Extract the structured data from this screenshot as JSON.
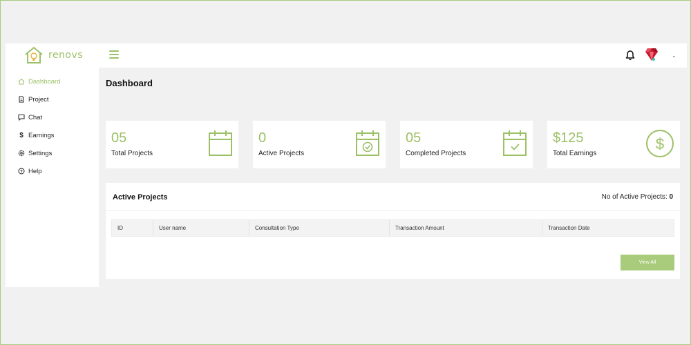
{
  "brand": {
    "name": "renovs",
    "accent": "#9cc066"
  },
  "topbar": {
    "menu_icon": "hamburger-icon",
    "notification_icon": "bell-icon",
    "avatar_icon": "ruby-avatar",
    "dropdown_icon": "chevron-down-icon"
  },
  "sidebar": {
    "items": [
      {
        "label": "Dashboard",
        "icon": "home-icon",
        "active": true
      },
      {
        "label": "Project",
        "icon": "document-icon",
        "active": false
      },
      {
        "label": "Chat",
        "icon": "chat-icon",
        "active": false
      },
      {
        "label": "Earnings",
        "icon": "dollar-icon",
        "active": false
      },
      {
        "label": "Settings",
        "icon": "gear-icon",
        "active": false
      },
      {
        "label": "Help",
        "icon": "help-icon",
        "active": false
      }
    ]
  },
  "main": {
    "title": "Dashboard",
    "stats": [
      {
        "value": "05",
        "label": "Total Projects",
        "icon": "calendar-icon"
      },
      {
        "value": "0",
        "label": "Active Projects",
        "icon": "calendar-check-circle-icon"
      },
      {
        "value": "05",
        "label": "Completed Projects",
        "icon": "calendar-check-icon"
      },
      {
        "value": "$125",
        "label": "Total Earnings",
        "icon": "dollar-circle-icon"
      }
    ],
    "active_projects": {
      "title": "Active Projects",
      "count_label": "No of Active Projects:",
      "count_value": "0",
      "columns": [
        "ID",
        "User name",
        "Consultation Type",
        "Transaction Amount",
        "Transaction Date"
      ],
      "rows": [],
      "view_all_label": "View All"
    }
  }
}
